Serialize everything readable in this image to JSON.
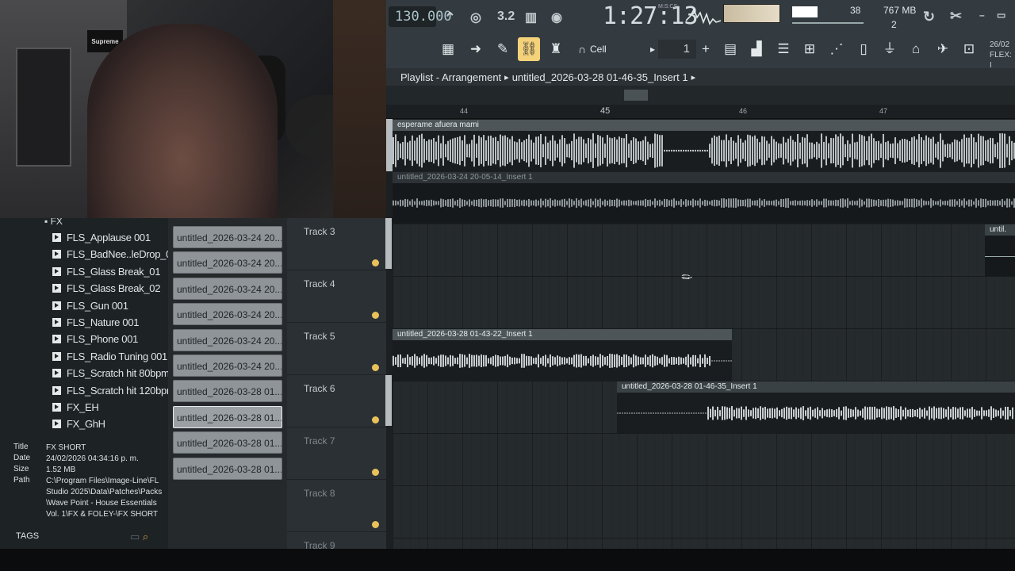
{
  "toolbar": {
    "tempo": "130.000",
    "time_main": "1:27:13",
    "time_sub": "M:S:CS",
    "cpu": "38",
    "memory": "767 MB",
    "polyphony": "2",
    "snap": "Cell",
    "pattern_number": "1",
    "date_hint_1": "26/02",
    "date_hint_2": "FLEX: I",
    "icons": [
      "metronome-icon",
      "wait-icon",
      "countdown-icon",
      "step-edit-icon",
      "loop-record-icon",
      "undo-icon",
      "cut-icon",
      "minimize-icon"
    ]
  },
  "playlist": {
    "title": "Playlist - Arrangement",
    "pattern": "untitled_2026-03-28 01-46-35_Insert 1",
    "ruler": [
      "44",
      "45",
      "46",
      "47"
    ]
  },
  "clips": {
    "top": "esperame afuera mami",
    "track2": "untitled_2026-03-24 20-05-14_Insert 1",
    "track3_right": "until.",
    "track5": "untitled_2026-03-28 01-43-22_Insert 1",
    "track6": "untitled_2026-03-28 01-46-35_Insert 1"
  },
  "tracks": [
    "Track 3",
    "Track 4",
    "Track 5",
    "Track 6",
    "Track 7",
    "Track 8",
    "Track 9"
  ],
  "browser": {
    "folder": "FX",
    "items": [
      "FLS_Applause 001",
      "FLS_BadNee..leDrop_02",
      "FLS_Glass Break_01",
      "FLS_Glass Break_02",
      "FLS_Gun 001",
      "FLS_Nature 001",
      "FLS_Phone 001",
      "FLS_Radio Tuning 001",
      "FLS_Scratch hit 80bpm",
      "FLS_Scratch hit 120bpm",
      "FX_EH",
      "FX_GhH"
    ],
    "info": {
      "title_label": "Title",
      "title": "FX SHORT",
      "date_label": "Date",
      "date": "24/02/2026 04:34:16 p. m.",
      "size_label": "Size",
      "size": "1.52 MB",
      "path_label": "Path",
      "path": "C:\\Program Files\\Image-Line\\FL Studio 2025\\Data\\Patches\\Packs\\Wave Point - House Essentials Vol. 1\\FX & FOLEY-\\FX SHORT"
    },
    "tags": "TAGS"
  },
  "picker": [
    "untitled_2026-03-24 20...",
    "untitled_2026-03-24 20...",
    "untitled_2026-03-24 20...",
    "untitled_2026-03-24 20...",
    "untitled_2026-03-24 20...",
    "untitled_2026-03-24 20...",
    "untitled_2026-03-28 01...",
    "untitled_2026-03-28 01...",
    "untitled_2026-03-28 01...",
    "untitled_2026-03-28 01..."
  ],
  "webcam": {
    "poster": "Supreme"
  }
}
